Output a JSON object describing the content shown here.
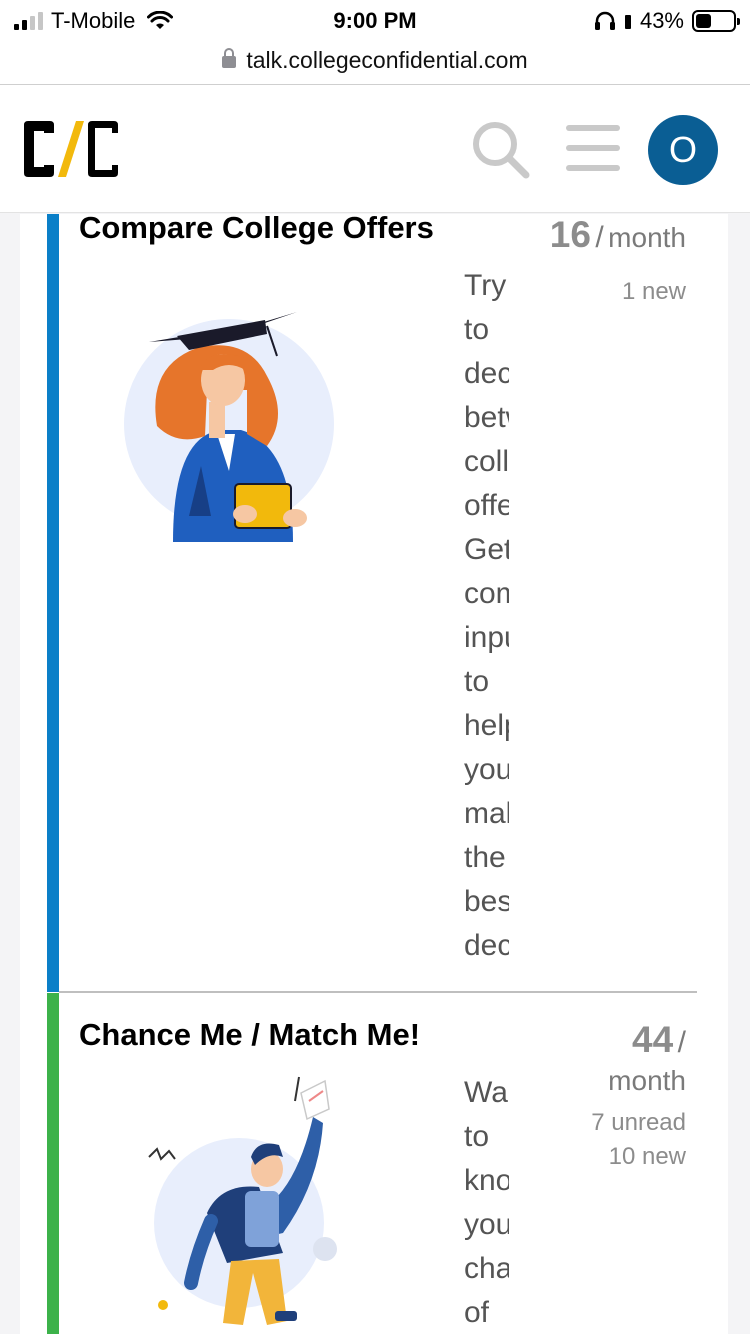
{
  "status": {
    "carrier": "T-Mobile",
    "time": "9:00 PM",
    "battery": "43%",
    "battery_level": 0.43
  },
  "browser": {
    "url": "talk.collegeconfidential.com"
  },
  "header": {
    "logo_alt": "C/C",
    "avatar_letter": "O",
    "icons": [
      "search-icon",
      "menu-icon"
    ]
  },
  "colors": {
    "accent_blue": "#0a5e94",
    "cat1_bar": "#0a7fc8",
    "cat2_bar": "#3cb24a",
    "logo_yellow": "#f2b90c"
  },
  "categories": [
    {
      "title": "Compare College Offers",
      "description_words": [
        "Try",
        "to",
        "decide",
        "between",
        "college",
        "offers?",
        "Get",
        "community",
        "input",
        "to",
        "help",
        "you",
        "make",
        "the",
        "best",
        "decision"
      ],
      "count": "16",
      "period": "month",
      "new": "1 new",
      "unread": ""
    },
    {
      "title": "Chance Me / Match Me!",
      "description_words": [
        "Want",
        "to",
        "know",
        "your",
        "chances",
        "of"
      ],
      "count": "44",
      "period": "month",
      "new": "10 new",
      "unread": "7 unread"
    }
  ]
}
